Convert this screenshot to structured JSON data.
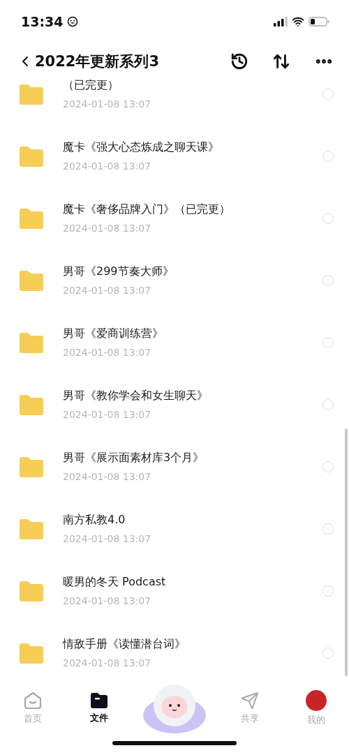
{
  "status_bar": {
    "time": "13:34"
  },
  "header": {
    "title": "2022年更新系列3"
  },
  "files": [
    {
      "name": "（已完更）",
      "date": "2024-01-08 13:07",
      "selected": false
    },
    {
      "name": "魔卡《强大心态炼成之聊天课》",
      "date": "2024-01-08 13:07",
      "selected": false
    },
    {
      "name": "魔卡《奢侈品牌入门》（已完更）",
      "date": "2024-01-08 13:07",
      "selected": false
    },
    {
      "name": "男哥《299节奏大师》",
      "date": "2024-01-08 13:07",
      "selected": false
    },
    {
      "name": "男哥《爱商训练营》",
      "date": "2024-01-08 13:07",
      "selected": false
    },
    {
      "name": "男哥《教你学会和女生聊天》",
      "date": "2024-01-08 13:07",
      "selected": false
    },
    {
      "name": "男哥《展示面素材库3个月》",
      "date": "2024-01-08 13:07",
      "selected": false
    },
    {
      "name": "南方私教4.0",
      "date": "2024-01-08 13:07",
      "selected": false
    },
    {
      "name": "暖男的冬天 Podcast",
      "date": "2024-01-08 13:07",
      "selected": false
    },
    {
      "name": "情敌手册《读懂潜台词》",
      "date": "2024-01-08 13:07",
      "selected": false
    }
  ],
  "tabs": [
    {
      "label": "首页",
      "kind": "home",
      "selected": false
    },
    {
      "label": "文件",
      "kind": "files",
      "selected": true
    },
    {
      "kind": "mascot"
    },
    {
      "label": "共享",
      "kind": "share",
      "selected": false
    },
    {
      "label": "我的",
      "kind": "me",
      "selected": false
    }
  ]
}
